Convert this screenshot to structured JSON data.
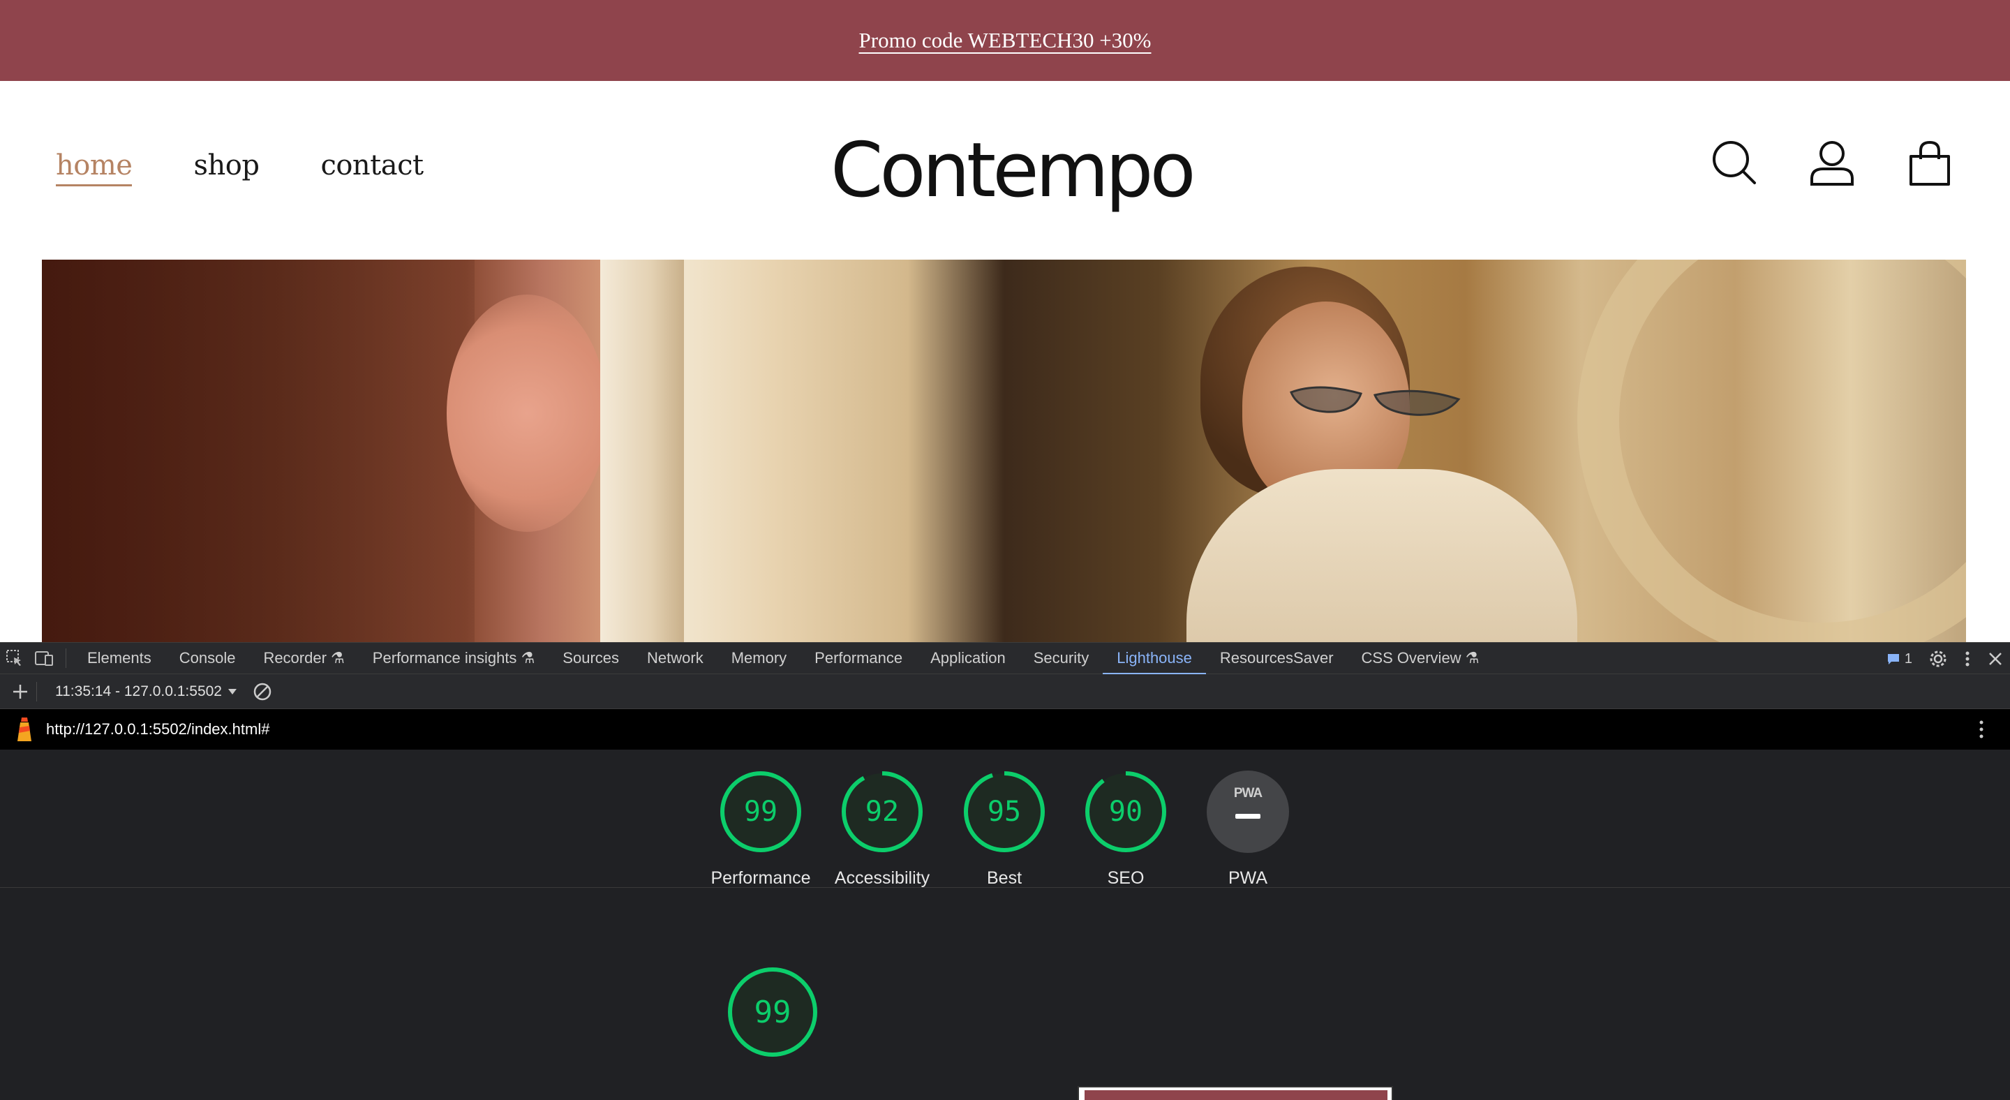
{
  "promo": {
    "text": "Promo code WEBTECH30 +30%"
  },
  "nav": {
    "items": [
      "home",
      "shop",
      "contact"
    ]
  },
  "brand": {
    "logo": "Contempo"
  },
  "header_icons": [
    "search-icon",
    "user-icon",
    "shopping-bag-icon"
  ],
  "colors": {
    "promo_bg": "#8f444c",
    "nav_active": "#b58363",
    "score_good": "#0cce6b",
    "devtools_bg": "#202124",
    "tab_active": "#8ab4f8"
  },
  "devtools": {
    "tabs": [
      "Elements",
      "Console",
      "Recorder",
      "Performance insights",
      "Sources",
      "Network",
      "Memory",
      "Performance",
      "Application",
      "Security",
      "Lighthouse",
      "ResourcesSaver",
      "CSS Overview"
    ],
    "active_tab": "Lighthouse",
    "issues_count": "1",
    "report_select": "11:35:14 - 127.0.0.1:5502",
    "url": "http://127.0.0.1:5502/index.html#",
    "scores": [
      {
        "label": "Performance",
        "value": 99
      },
      {
        "label": "Accessibility",
        "value": 92
      },
      {
        "label": "Best Practices",
        "value": 95
      },
      {
        "label": "SEO",
        "value": 90
      }
    ],
    "pwa": {
      "badge": "PWA",
      "label": "PWA"
    },
    "summary_score": 99
  }
}
